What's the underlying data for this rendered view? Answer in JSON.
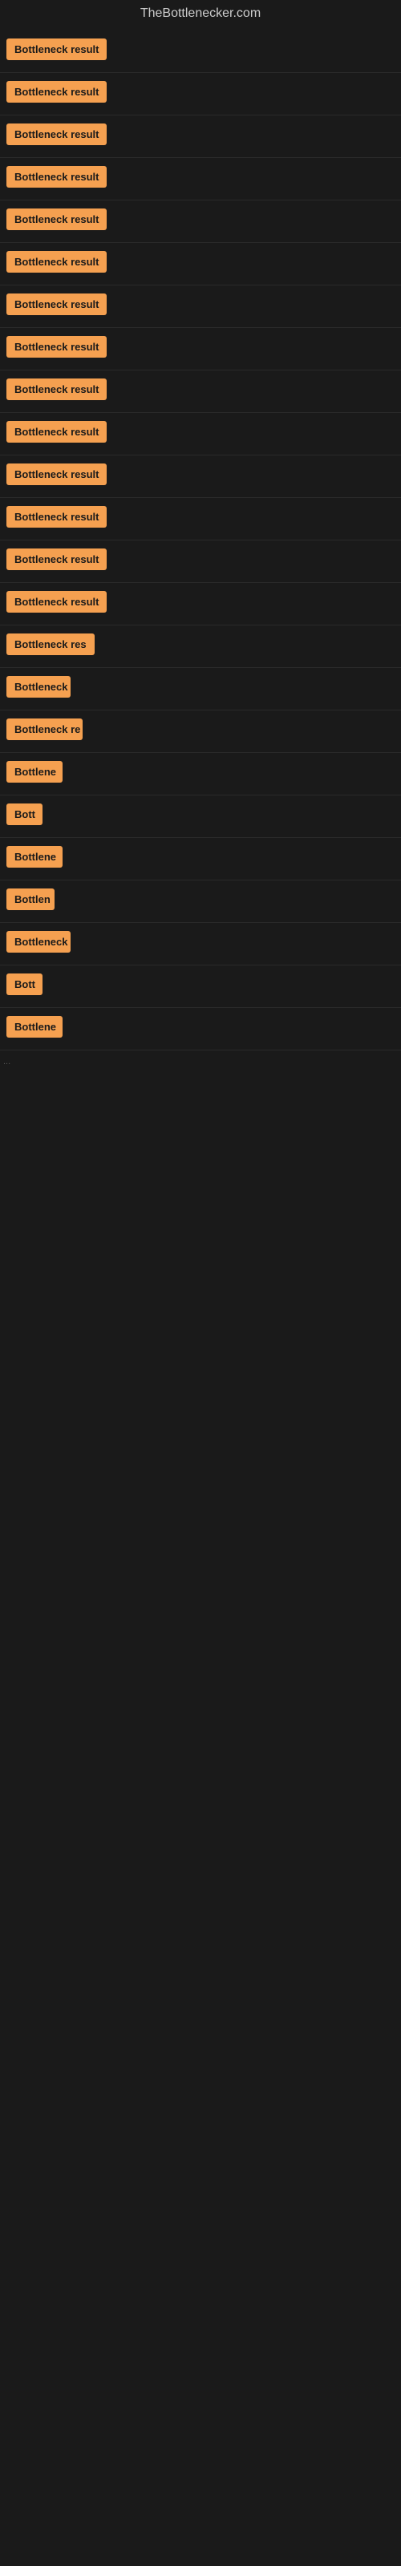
{
  "site": {
    "title": "TheBottlenecker.com"
  },
  "items": [
    {
      "id": 1,
      "label": "Bottleneck result",
      "width": 130
    },
    {
      "id": 2,
      "label": "Bottleneck result",
      "width": 130
    },
    {
      "id": 3,
      "label": "Bottleneck result",
      "width": 130
    },
    {
      "id": 4,
      "label": "Bottleneck result",
      "width": 130
    },
    {
      "id": 5,
      "label": "Bottleneck result",
      "width": 130
    },
    {
      "id": 6,
      "label": "Bottleneck result",
      "width": 130
    },
    {
      "id": 7,
      "label": "Bottleneck result",
      "width": 130
    },
    {
      "id": 8,
      "label": "Bottleneck result",
      "width": 130
    },
    {
      "id": 9,
      "label": "Bottleneck result",
      "width": 130
    },
    {
      "id": 10,
      "label": "Bottleneck result",
      "width": 130
    },
    {
      "id": 11,
      "label": "Bottleneck result",
      "width": 130
    },
    {
      "id": 12,
      "label": "Bottleneck result",
      "width": 130
    },
    {
      "id": 13,
      "label": "Bottleneck result",
      "width": 130
    },
    {
      "id": 14,
      "label": "Bottleneck result",
      "width": 130
    },
    {
      "id": 15,
      "label": "Bottleneck res",
      "width": 110
    },
    {
      "id": 16,
      "label": "Bottleneck",
      "width": 80
    },
    {
      "id": 17,
      "label": "Bottleneck re",
      "width": 95
    },
    {
      "id": 18,
      "label": "Bottlene",
      "width": 70
    },
    {
      "id": 19,
      "label": "Bott",
      "width": 45
    },
    {
      "id": 20,
      "label": "Bottlene",
      "width": 70
    },
    {
      "id": 21,
      "label": "Bottlen",
      "width": 60
    },
    {
      "id": 22,
      "label": "Bottleneck",
      "width": 80
    },
    {
      "id": 23,
      "label": "Bott",
      "width": 45
    },
    {
      "id": 24,
      "label": "Bottlene",
      "width": 70
    }
  ],
  "dots": "..."
}
